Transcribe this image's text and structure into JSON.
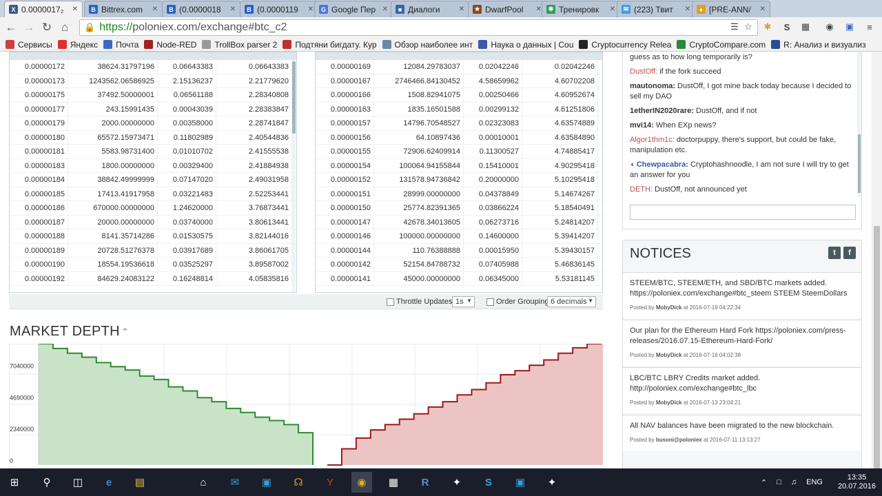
{
  "browser": {
    "tabs": [
      {
        "title": "0.0000017₂",
        "icon_color": "#3a5a8c",
        "glyph": "X"
      },
      {
        "title": "Bittrex.com",
        "icon_color": "#2a62c8",
        "glyph": "B"
      },
      {
        "title": "(0.0000018",
        "icon_color": "#2a62c8",
        "glyph": "B"
      },
      {
        "title": "(0.0000119",
        "icon_color": "#2a62c8",
        "glyph": "B"
      },
      {
        "title": "Google Пер",
        "icon_color": "#4a7ad8",
        "glyph": "G"
      },
      {
        "title": "Диалоги",
        "icon_color": "#3a66a8",
        "glyph": "■"
      },
      {
        "title": "DwarfPool",
        "icon_color": "#8a4a1a",
        "glyph": "★"
      },
      {
        "title": "Тренировк",
        "icon_color": "#2aa05a",
        "glyph": "✱"
      },
      {
        "title": "(223) Твит",
        "icon_color": "#3aa0e0",
        "glyph": "✉"
      },
      {
        "title": "[PRE-ANN/",
        "icon_color": "#e0a020",
        "glyph": "●"
      }
    ],
    "url_https": "https://",
    "url_rest": "poloniex.com/exchange#btc_c2",
    "bookmarks": [
      {
        "label": "Сервисы",
        "color": "#d04040"
      },
      {
        "label": "Яндекс",
        "color": "#e03030"
      },
      {
        "label": "Почта",
        "color": "#3a6ac8"
      },
      {
        "label": "Node-RED",
        "color": "#a02020"
      },
      {
        "label": "TrollBox parser 2",
        "color": "#999999"
      },
      {
        "label": "Подтяни бигдату. Кур",
        "color": "#c03030"
      },
      {
        "label": "Обзор наиболее инт",
        "color": "#6a8aa8"
      },
      {
        "label": "Наука о данных | Cou",
        "color": "#3a5aa8"
      },
      {
        "label": "Cryptocurrency Relea",
        "color": "#222222"
      },
      {
        "label": "CryptoCompare.com",
        "color": "#2a8a3a"
      },
      {
        "label": "R: Анализ и визуализ",
        "color": "#2a4a9a"
      }
    ]
  },
  "sell_orders": [
    [
      "0.00000172",
      "38624.31797196",
      "0.06643383",
      "0.06643383"
    ],
    [
      "0.00000173",
      "1243562.06586925",
      "2.15136237",
      "2.21779620"
    ],
    [
      "0.00000175",
      "37492.50000001",
      "0.06561188",
      "2.28340808"
    ],
    [
      "0.00000177",
      "243.15991435",
      "0.00043039",
      "2.28383847"
    ],
    [
      "0.00000179",
      "2000.00000000",
      "0.00358000",
      "2.28741847"
    ],
    [
      "0.00000180",
      "65572.15973471",
      "0.11802989",
      "2.40544836"
    ],
    [
      "0.00000181",
      "5583.98731400",
      "0.01010702",
      "2.41555538"
    ],
    [
      "0.00000183",
      "1800.00000000",
      "0.00329400",
      "2.41884938"
    ],
    [
      "0.00000184",
      "38842.49999999",
      "0.07147020",
      "2.49031958"
    ],
    [
      "0.00000185",
      "17413.41917958",
      "0.03221483",
      "2.52253441"
    ],
    [
      "0.00000186",
      "670000.00000000",
      "1.24620000",
      "3.76873441"
    ],
    [
      "0.00000187",
      "20000.00000000",
      "0.03740000",
      "3.80613441"
    ],
    [
      "0.00000188",
      "8141.35714286",
      "0.01530575",
      "3.82144016"
    ],
    [
      "0.00000189",
      "20728.51276378",
      "0.03917689",
      "3.86061705"
    ],
    [
      "0.00000190",
      "18554.19536618",
      "0.03525297",
      "3.89587002"
    ],
    [
      "0.00000192",
      "84629.24083122",
      "0.16248814",
      "4.05835816"
    ]
  ],
  "buy_orders": [
    [
      "0.00000169",
      "12084.29783037",
      "0.02042246",
      "0.02042246"
    ],
    [
      "0.00000167",
      "2746466.84130452",
      "4.58659962",
      "4.60702208"
    ],
    [
      "0.00000166",
      "1508.82941075",
      "0.00250466",
      "4.60952674"
    ],
    [
      "0.00000163",
      "1835.16501588",
      "0.00299132",
      "4.61251806"
    ],
    [
      "0.00000157",
      "14796.70548527",
      "0.02323083",
      "4.63574889"
    ],
    [
      "0.00000156",
      "64.10897436",
      "0.00010001",
      "4.63584890"
    ],
    [
      "0.00000155",
      "72906.62409914",
      "0.11300527",
      "4.74885417"
    ],
    [
      "0.00000154",
      "100064.94155844",
      "0.15410001",
      "4.90295418"
    ],
    [
      "0.00000152",
      "131578.94736842",
      "0.20000000",
      "5.10295418"
    ],
    [
      "0.00000151",
      "28999.00000000",
      "0.04378849",
      "5.14674267"
    ],
    [
      "0.00000150",
      "25774.82391365",
      "0.03866224",
      "5.18540491"
    ],
    [
      "0.00000147",
      "42678.34013605",
      "0.06273716",
      "5.24814207"
    ],
    [
      "0.00000146",
      "100000.00000000",
      "0.14600000",
      "5.39414207"
    ],
    [
      "0.00000144",
      "110.76388888",
      "0.00015950",
      "5.39430157"
    ],
    [
      "0.00000142",
      "52154.84788732",
      "0.07405988",
      "5.46836145"
    ],
    [
      "0.00000141",
      "45000.00000000",
      "0.06345000",
      "5.53181145"
    ]
  ],
  "orderbook_footer": {
    "throttle_label": "Throttle Updates",
    "throttle_value": "1s",
    "grouping_label": "Order Grouping",
    "grouping_value": "6 decimals"
  },
  "market_depth": {
    "title": "MARKET DEPTH"
  },
  "chart_data": {
    "type": "area",
    "yticks": [
      "7040000",
      "4690000",
      "2340000",
      "0"
    ],
    "ylim": [
      0,
      9000000
    ],
    "bid_series": {
      "name": "bids",
      "color": "#c9e3c9",
      "line": "#2f8a2f",
      "x": [
        0,
        1,
        2,
        3,
        4,
        5,
        6,
        7,
        8,
        9,
        10,
        11,
        12,
        13,
        14,
        15,
        16,
        17,
        18,
        19
      ],
      "y": [
        9000000,
        8650000,
        8300000,
        8000000,
        7600000,
        7300000,
        7050000,
        6600000,
        6350000,
        5800000,
        5500000,
        5000000,
        4700000,
        4200000,
        3900000,
        3550000,
        3300000,
        3000000,
        2400000,
        0
      ]
    },
    "ask_series": {
      "name": "asks",
      "color": "#ecc4c4",
      "line": "#9a1a1a",
      "x": [
        20,
        21,
        22,
        23,
        24,
        25,
        26,
        27,
        28,
        29,
        30,
        31,
        32,
        33,
        34,
        35,
        36,
        37,
        38,
        39
      ],
      "y": [
        0,
        1200000,
        2000000,
        2600000,
        3000000,
        3400000,
        3800000,
        4300000,
        4700000,
        5200000,
        5600000,
        6100000,
        6700000,
        7000000,
        7400000,
        7800000,
        8300000,
        8700000,
        9000000,
        9000000
      ]
    }
  },
  "chat": {
    "messages": [
      {
        "user": "",
        "text": "guess as to how long temporarily is?"
      },
      {
        "user": "DustOff:",
        "text": " if the fork succeed",
        "red": true
      },
      {
        "user": "mautonoma:",
        "text": " DustOff, I got mine back today because I decided to sell my DAO"
      },
      {
        "user": "1etherIN2020rare:",
        "text": " DustOff, and if not"
      },
      {
        "user": "mvi14:",
        "text": " When EXp news?"
      },
      {
        "user": "Algor1thm1c:",
        "text": " doctorpuppy, there's support, but could be fake, manipulation etc.",
        "red": true
      },
      {
        "user": "Chewpacabra:",
        "text": " Cryptohashnoodle, I am not sure I will try to get an answer for you",
        "blue": true
      },
      {
        "user": "DETH:",
        "text": " DustOff, not announced yet",
        "red": true
      }
    ]
  },
  "notices": {
    "title": "NOTICES",
    "items": [
      {
        "text": "STEEM/BTC, STEEM/ETH, and SBD/BTC markets added. https://poloniex.com/exchange#btc_steem STEEM SteemDollars",
        "by": "MobyDick",
        "at": "at 2016-07-19 04:22:34"
      },
      {
        "text": "Our plan for the Ethereum Hard Fork https://poloniex.com/press-releases/2016.07.15-Ethereum-Hard-Fork/",
        "by": "MobyDick",
        "at": "at 2016-07-16 04:02:38"
      },
      {
        "text": "LBC/BTC LBRY Credits market added. http://poloniex.com/exchange#btc_lbc",
        "by": "MobyDick",
        "at": "at 2016-07-13 23:04:21"
      },
      {
        "text": "All NAV balances have been migrated to the new blockchain.",
        "by": "busoni@poloniex",
        "at": "at 2016-07-11 13:13:27"
      }
    ],
    "posted_by": "Posted by"
  },
  "taskbar": {
    "lang": "ENG",
    "time": "13:35",
    "date": "20.07.2016"
  }
}
